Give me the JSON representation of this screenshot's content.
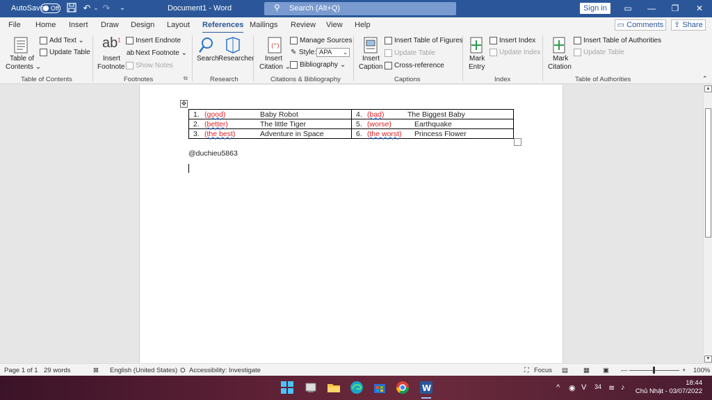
{
  "titlebar": {
    "autosave_label": "AutoSave",
    "autosave_state": "Off",
    "doc_title": "Document1 - Word",
    "search_placeholder": "Search (Alt+Q)",
    "signin_label": "Sign in"
  },
  "tabs": [
    "File",
    "Home",
    "Insert",
    "Draw",
    "Design",
    "Layout",
    "References",
    "Mailings",
    "Review",
    "View",
    "Help"
  ],
  "active_tab": "References",
  "comments_label": "Comments",
  "share_label": "Share",
  "ribbon": {
    "toc": {
      "btn1": "Table of",
      "btn2": "Contents",
      "add_text": "Add Text",
      "update_table": "Update Table",
      "group": "Table of Contents"
    },
    "footnotes": {
      "insert1": "Insert",
      "insert2": "Footnote",
      "insert_endnote": "Insert Endnote",
      "next_footnote": "Next Footnote",
      "show_notes": "Show Notes",
      "group": "Footnotes"
    },
    "research": {
      "search": "Search",
      "researcher": "Researcher",
      "group": "Research"
    },
    "citations": {
      "insert1": "Insert",
      "insert2": "Citation",
      "manage_sources": "Manage Sources",
      "style_label": "Style:",
      "style_value": "APA",
      "bibliography": "Bibliography",
      "group": "Citations & Bibliography"
    },
    "captions": {
      "insert1": "Insert",
      "insert2": "Caption",
      "insert_tof": "Insert Table of Figures",
      "update_table": "Update Table",
      "cross_ref": "Cross-reference",
      "group": "Captions"
    },
    "index": {
      "mark1": "Mark",
      "mark2": "Entry",
      "insert_index": "Insert Index",
      "update_index": "Update Index",
      "group": "Index"
    },
    "toa": {
      "mark1": "Mark",
      "mark2": "Citation",
      "insert_toa": "Insert Table of Authorities",
      "update_table": "Update Table",
      "group": "Table of Authorities"
    }
  },
  "document": {
    "rows": [
      {
        "n1": "1.",
        "a1": "(good)",
        "t1": "Baby Robot",
        "n2": "4.",
        "a2": "(bad)",
        "t2": "The Biggest Baby"
      },
      {
        "n1": "2.",
        "a1": "(better)",
        "t1": "The little Tiger",
        "n2": "5.",
        "a2": "(worse)",
        "t2": "Earthquake"
      },
      {
        "n1": "3.",
        "a1": "(the best)",
        "t1": "Adventure in Space",
        "n2": "6.",
        "a2": "(the worst)",
        "t2": "Princess Flower"
      }
    ],
    "handle": "@duchieu5863"
  },
  "statusbar": {
    "page": "Page 1 of 1",
    "words": "29 words",
    "language": "English (United States)",
    "accessibility": "Accessibility: Investigate",
    "focus": "Focus",
    "zoom": "100%"
  },
  "taskbar": {
    "weather_num": "34",
    "time": "18:44",
    "date": "Chủ Nhật - 03/07/2022"
  },
  "colors": {
    "accent": "#2b579a",
    "red_text": "#e02020"
  }
}
